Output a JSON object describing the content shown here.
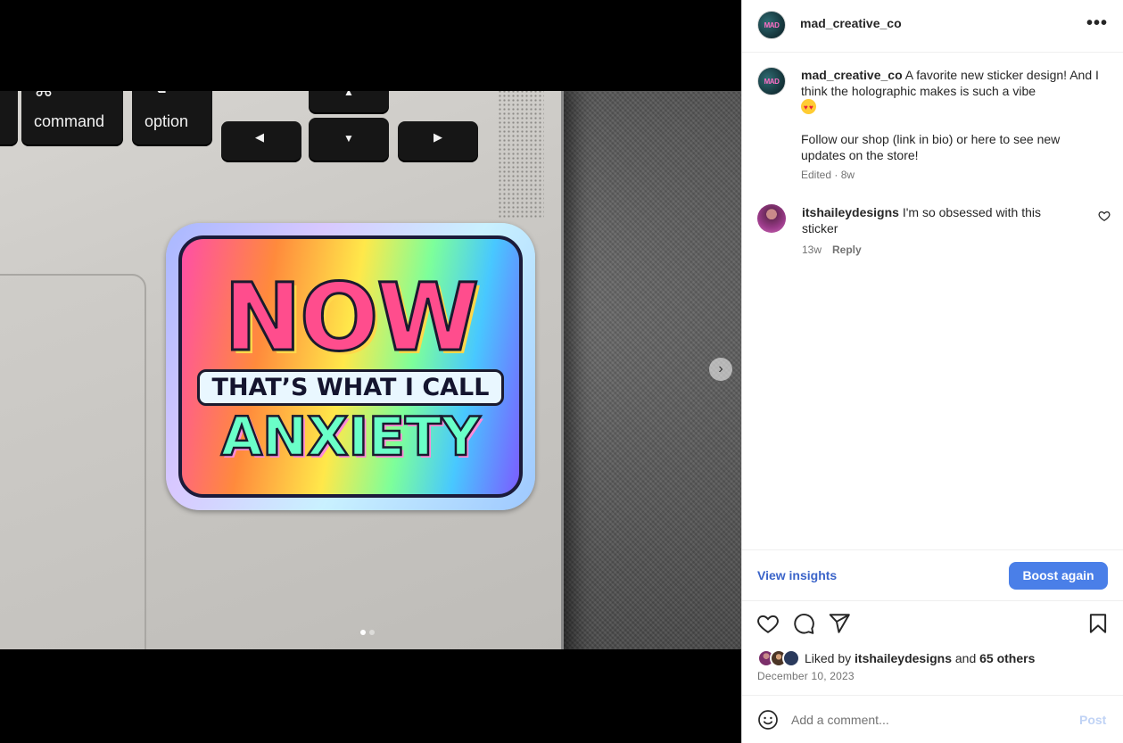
{
  "post": {
    "username": "mad_creative_co",
    "avatar_text": "MAD",
    "more_icon": "more-horizontal-icon"
  },
  "media": {
    "keys": {
      "command_symbol": "⌘",
      "command_label": "command",
      "option_symbol": "⌥",
      "option_label": "option",
      "left_arrow": "◀",
      "up_arrow": "▲",
      "down_arrow": "▼",
      "right_arrow": "▶"
    },
    "sticker": {
      "line1": "NOW",
      "line2": "THAT’S WHAT I CALL",
      "line3": "ANXIETY"
    },
    "next_icon": "chevron-right-icon",
    "carousel_count": 2,
    "carousel_active": 0
  },
  "caption": {
    "username": "mad_creative_co",
    "text_line1": "A favorite new sticker design! And I think the holographic makes is such a vibe",
    "emoji": "heart-eyes-emoji",
    "text_line2": "Follow our shop (link in bio) or here to see new updates on the store!",
    "meta": "Edited · 8w"
  },
  "comment": {
    "username": "itshaileydesigns",
    "text": "I'm so obsessed with this sticker",
    "time": "13w",
    "reply": "Reply"
  },
  "insights": {
    "view_label": "View insights",
    "boost_label": "Boost again"
  },
  "likes": {
    "prefix": "Liked by",
    "user": "itshaileydesigns",
    "and": "and",
    "others": "65 others"
  },
  "date": "December 10, 2023",
  "add_comment": {
    "placeholder": "Add a comment...",
    "post_label": "Post"
  },
  "colors": {
    "link_blue": "#3b64c9",
    "boost_blue": "#4a7fe8",
    "post_disabled": "#c0d3f5"
  }
}
